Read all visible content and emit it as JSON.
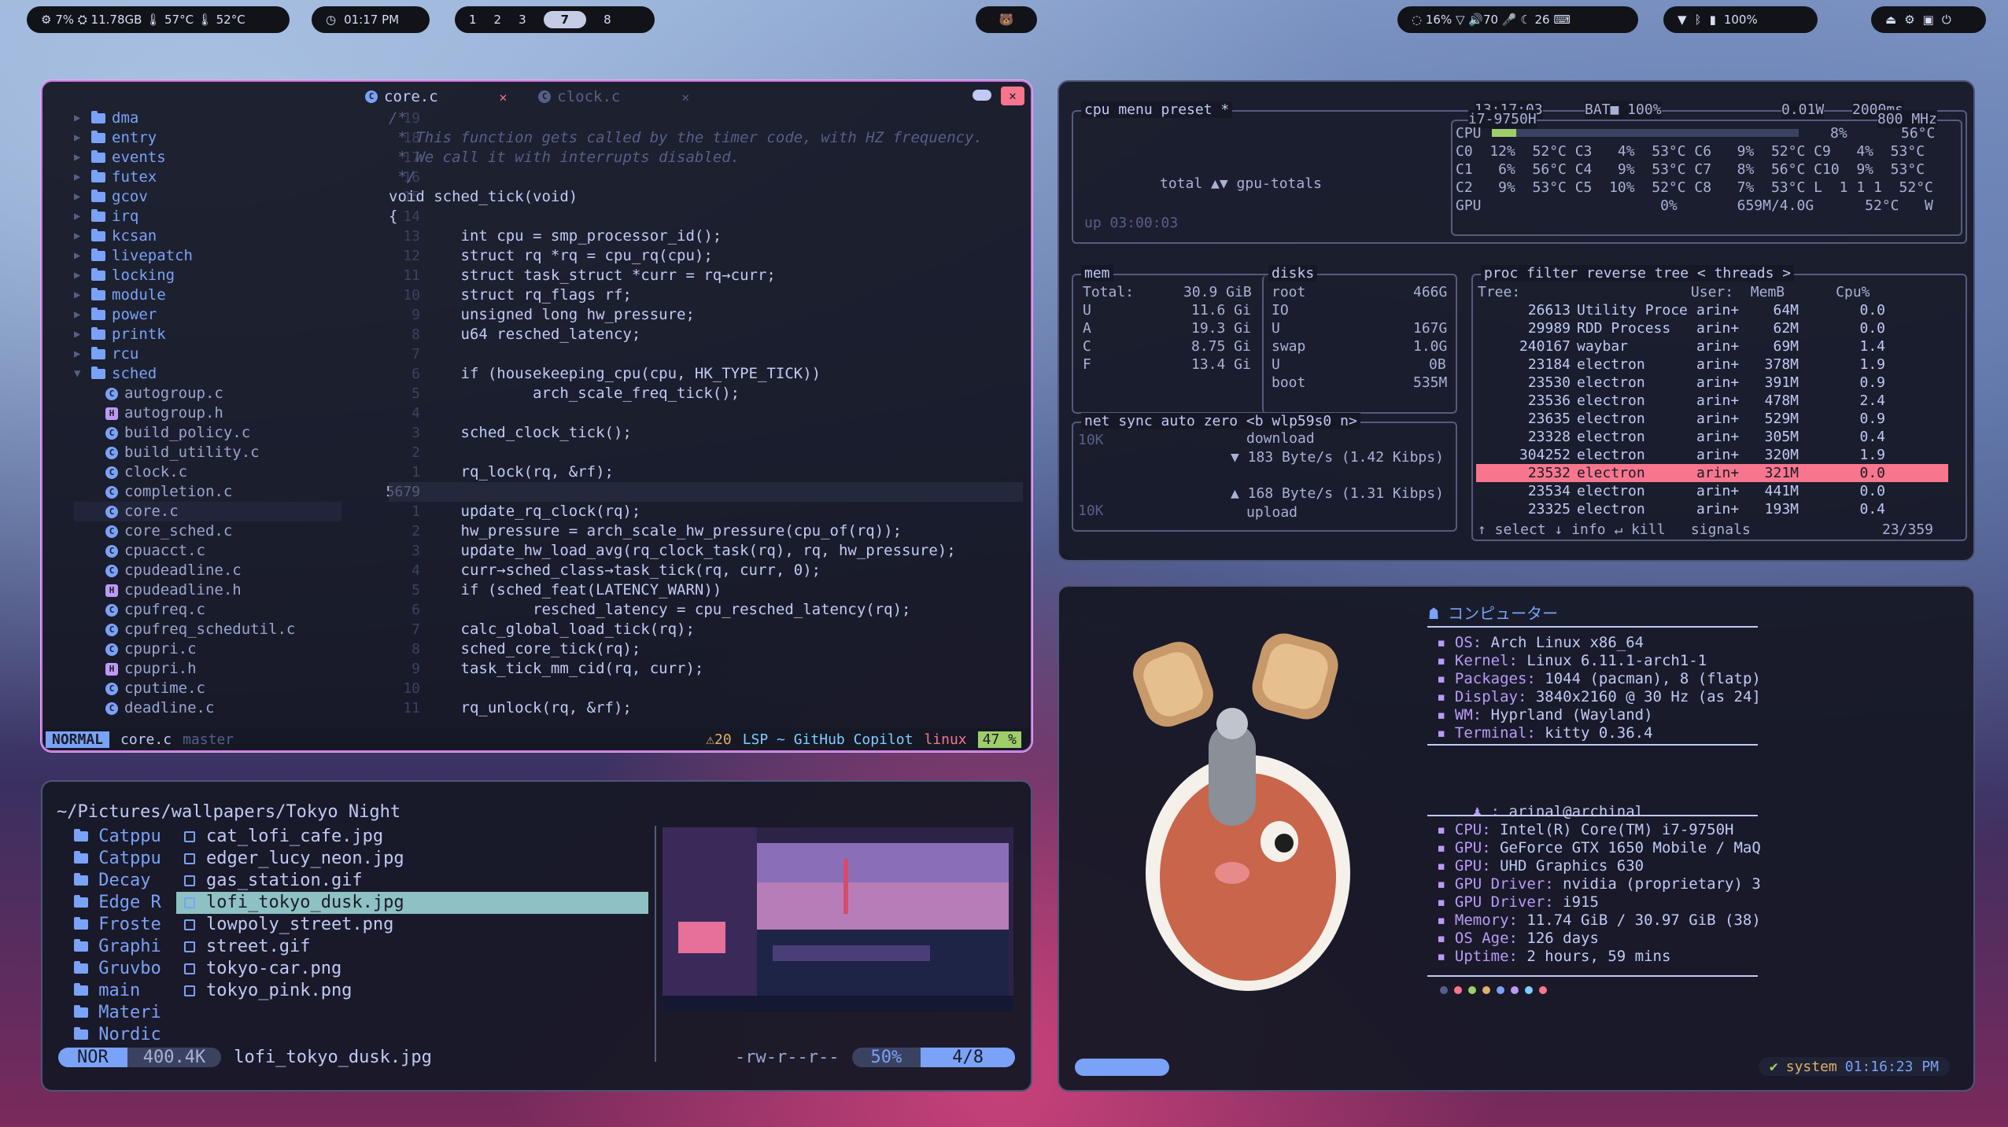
{
  "topbar": {
    "sysinfo": "⚙ 7%  ⛭ 11.78GB  🌡 57°C  🌡 52°C",
    "clock": "01:17 PM",
    "workspaces": [
      "1",
      "2",
      "3",
      "7",
      "8"
    ],
    "active_workspace": "7",
    "tray_right1": "◌ 16%   ▽ 🔊70  🎤  ☾ 26  ⌨",
    "battery": "100%"
  },
  "editor": {
    "tabs": [
      {
        "label": "core.c"
      },
      {
        "label": "clock.c"
      }
    ],
    "tree": [
      {
        "type": "dir",
        "name": "dma"
      },
      {
        "type": "dir",
        "name": "entry"
      },
      {
        "type": "dir",
        "name": "events"
      },
      {
        "type": "dir",
        "name": "futex"
      },
      {
        "type": "dir",
        "name": "gcov"
      },
      {
        "type": "dir",
        "name": "irq"
      },
      {
        "type": "dir",
        "name": "kcsan"
      },
      {
        "type": "dir",
        "name": "livepatch"
      },
      {
        "type": "dir",
        "name": "locking"
      },
      {
        "type": "dir",
        "name": "module"
      },
      {
        "type": "dir",
        "name": "power"
      },
      {
        "type": "dir",
        "name": "printk"
      },
      {
        "type": "dir",
        "name": "rcu"
      },
      {
        "type": "dir-open",
        "name": "sched"
      },
      {
        "type": "c",
        "name": "autogroup.c"
      },
      {
        "type": "h",
        "name": "autogroup.h"
      },
      {
        "type": "c",
        "name": "build_policy.c"
      },
      {
        "type": "c",
        "name": "build_utility.c"
      },
      {
        "type": "c",
        "name": "clock.c"
      },
      {
        "type": "c",
        "name": "completion.c"
      },
      {
        "type": "c",
        "name": "core.c"
      },
      {
        "type": "c",
        "name": "core_sched.c"
      },
      {
        "type": "c",
        "name": "cpuacct.c"
      },
      {
        "type": "c",
        "name": "cpudeadline.c"
      },
      {
        "type": "h",
        "name": "cpudeadline.h"
      },
      {
        "type": "c",
        "name": "cpufreq.c"
      },
      {
        "type": "c",
        "name": "cpufreq_schedutil.c"
      },
      {
        "type": "c",
        "name": "cpupri.c"
      },
      {
        "type": "h",
        "name": "cpupri.h"
      },
      {
        "type": "c",
        "name": "cputime.c"
      },
      {
        "type": "c",
        "name": "deadline.c"
      }
    ],
    "gutter": [
      "19",
      "18",
      "17",
      "16",
      "15",
      "14",
      "13",
      "12",
      "11",
      "10",
      "9",
      "8",
      "7",
      "6",
      "5",
      "4",
      "3",
      "2",
      "1",
      "5679",
      "1",
      "2",
      "3",
      "4",
      "5",
      "6",
      "7",
      "8",
      "9",
      "10",
      "11"
    ],
    "code": [
      "/*",
      " * This function gets called by the timer code, with HZ frequency.",
      " * We call it with interrupts disabled.",
      " */",
      "void sched_tick(void)",
      "{",
      "        int cpu = smp_processor_id();",
      "        struct rq *rq = cpu_rq(cpu);",
      "        struct task_struct *curr = rq→curr;",
      "        struct rq_flags rf;",
      "        unsigned long hw_pressure;",
      "        u64 resched_latency;",
      "",
      "        if (housekeeping_cpu(cpu, HK_TYPE_TICK))",
      "                arch_scale_freq_tick();",
      "",
      "        sched_clock_tick();",
      "",
      "        rq_lock(rq, &rf);",
      "",
      "        update_rq_clock(rq);",
      "        hw_pressure = arch_scale_hw_pressure(cpu_of(rq));",
      "        update_hw_load_avg(rq_clock_task(rq), rq, hw_pressure);",
      "        curr→sched_class→task_tick(rq, curr, 0);",
      "        if (sched_feat(LATENCY_WARN))",
      "                resched_latency = cpu_resched_latency(rq);",
      "        calc_global_load_tick(rq);",
      "        sched_core_tick(rq);",
      "        task_tick_mm_cid(rq, curr);",
      "",
      "        rq_unlock(rq, &rf);"
    ],
    "status": {
      "mode": "NORMAL",
      "file": "core.c",
      "branch": "master",
      "warnings": "⚠20",
      "lsp": "LSP ~ GitHub Copilot",
      "os": "linux",
      "percent": "47 %"
    }
  },
  "btop": {
    "cpu_header": "cpu  menu  preset *",
    "time": "13:17:03",
    "bat": "BAT■ 100%",
    "power": "0.01W",
    "interval": "2000ms",
    "model": "i7-9750H",
    "freq": "800 MHz",
    "cpu_total_pct": "8%",
    "cpu_total_temp": "56°C",
    "cores": [
      "C0  12%  52°C C3   4%  53°C C6   9%  52°C C9   4%  53°C",
      "C1   6%  56°C C4   9%  53°C C7   8%  56°C C10  9%  53°C",
      "C2   9%  53°C C5  10%  52°C C8   7%  53°C L  1 1 1  52°C"
    ],
    "gpu_line": "GPU                     0%       659M/4.0G      52°C   W",
    "total_label": "total ▲▼ gpu-totals",
    "uptime": "up 03:00:03",
    "mem": {
      "total": "30.9 GiB",
      "rows": [
        [
          "U",
          "11.6 Gi"
        ],
        [
          "A",
          "19.3 Gi"
        ],
        [
          "C",
          "8.75 Gi"
        ],
        [
          "F",
          "13.4 Gi"
        ]
      ]
    },
    "disks": {
      "root": "466G",
      "io": "IO",
      "u1": "167G",
      "swap": "1.0G",
      "u2": "0B",
      "boot": "535M"
    },
    "net": {
      "label": "net  sync  auto  zero  <b wlp59s0 n>",
      "scale_top": "10K",
      "scale_bot": "10K",
      "download_label": "download",
      "down": "▼ 183 Byte/s (1.42 Kibps)",
      "up": "▲ 168 Byte/s (1.31 Kibps)",
      "upload_label": "upload"
    },
    "proc": {
      "header": "proc  filter        reverse  tree  < threads >",
      "cols": "Tree:                    User:  MemB      Cpu%",
      "rows": [
        {
          "pid": "26613",
          "name": "Utility Proce",
          "user": "arin+",
          "mem": "64M",
          "cpu": "0.0"
        },
        {
          "pid": "29989",
          "name": "RDD Process",
          "user": "arin+",
          "mem": "62M",
          "cpu": "0.0"
        },
        {
          "pid": "240167",
          "name": "waybar",
          "user": "arin+",
          "mem": "69M",
          "cpu": "1.4"
        },
        {
          "pid": "23184",
          "name": "electron",
          "user": "arin+",
          "mem": "378M",
          "cpu": "1.9"
        },
        {
          "pid": "23530",
          "name": "electron",
          "user": "arin+",
          "mem": "391M",
          "cpu": "0.9"
        },
        {
          "pid": "23536",
          "name": "electron",
          "user": "arin+",
          "mem": "478M",
          "cpu": "2.4"
        },
        {
          "pid": "23635",
          "name": "electron",
          "user": "arin+",
          "mem": "529M",
          "cpu": "0.9"
        },
        {
          "pid": "23328",
          "name": "electron",
          "user": "arin+",
          "mem": "305M",
          "cpu": "0.4"
        },
        {
          "pid": "304252",
          "name": "electron",
          "user": "arin+",
          "mem": "320M",
          "cpu": "1.9"
        },
        {
          "pid": "23532",
          "name": "electron",
          "user": "arin+",
          "mem": "321M",
          "cpu": "0.0"
        },
        {
          "pid": "23534",
          "name": "electron",
          "user": "arin+",
          "mem": "441M",
          "cpu": "0.0"
        },
        {
          "pid": "23325",
          "name": "electron",
          "user": "arin+",
          "mem": "193M",
          "cpu": "0.4"
        }
      ],
      "footer": "↑ select ↓ info ↵ kill   signals",
      "count": "23/359"
    }
  },
  "files": {
    "path": "~/Pictures/wallpapers/Tokyo Night",
    "dirs": [
      "Catppu",
      "Catppu",
      "Decay",
      "Edge R",
      "Froste",
      "Graphi",
      "Gruvbo",
      "main",
      "Materi",
      "Nordic"
    ],
    "items": [
      "cat_lofi_cafe.jpg",
      "edger_lucy_neon.jpg",
      "gas_station.gif",
      "lofi_tokyo_dusk.jpg",
      "lowpoly_street.png",
      "street.gif",
      "tokyo-car.png",
      "tokyo_pink.png"
    ],
    "selected": "lofi_tokyo_dusk.jpg",
    "status": {
      "mode": "NOR",
      "size": "400.4K",
      "file": "lofi_tokyo_dusk.jpg",
      "perms": "-rw-r--r--",
      "pct": "50%",
      "pos": "4/8"
    }
  },
  "fetch": {
    "title": "コンピューター",
    "sys": [
      [
        "OS",
        "Arch Linux x86_64"
      ],
      [
        "Kernel",
        "Linux 6.11.1-arch1-1"
      ],
      [
        "Packages",
        "1044 (pacman), 8 (flatp)"
      ],
      [
        "Display",
        "3840x2160 @ 30 Hz (as 24]"
      ],
      [
        "WM",
        "Hyprland (Wayland)"
      ],
      [
        "Terminal",
        "kitty 0.36.4"
      ]
    ],
    "user": "arinal@archinal",
    "hw": [
      [
        "CPU",
        "Intel(R) Core(TM) i7-9750H"
      ],
      [
        "GPU",
        "GeForce GTX 1650 Mobile / MaQ"
      ],
      [
        "GPU",
        "UHD Graphics 630"
      ],
      [
        "GPU Driver",
        "nvidia (proprietary) 3"
      ],
      [
        "GPU Driver",
        "i915"
      ],
      [
        "Memory",
        "11.74 GiB / 30.97 GiB (38)"
      ],
      [
        "OS Age",
        "126 days"
      ],
      [
        "Uptime",
        "2 hours, 59 mins"
      ]
    ],
    "dot_colors": [
      "#565f89",
      "#f7768e",
      "#9ece6a",
      "#e0af68",
      "#7aa2f7",
      "#bb9af7",
      "#7dcfff",
      "#f7768e"
    ],
    "status_label": "system",
    "status_time": "01:16:23 PM"
  }
}
